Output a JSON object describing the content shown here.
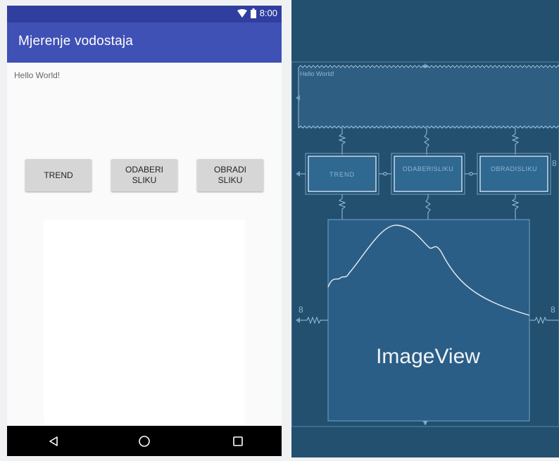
{
  "status_bar": {
    "time": "8:00",
    "icons": [
      "wifi-icon",
      "battery-icon"
    ],
    "color": "#303f9f"
  },
  "app_bar": {
    "title": "Mjerenje vodostaja",
    "color": "#3f51b5"
  },
  "content": {
    "hello_text": "Hello World!",
    "buttons": [
      {
        "label": "TREND"
      },
      {
        "label": "ODABERI\nSLIKU"
      },
      {
        "label": "OBRADI\nSLIKU"
      }
    ]
  },
  "nav_bar": {
    "icons": [
      "back-icon",
      "home-icon",
      "recents-icon"
    ]
  },
  "blueprint": {
    "background": "#24506f",
    "hello_text": "Hello World!",
    "buttons": [
      "TREND",
      "ODABERISLIKU",
      "OBRADISLIKU"
    ],
    "imageview_label": "ImageView",
    "margins": [
      "8",
      "8",
      "8"
    ]
  }
}
